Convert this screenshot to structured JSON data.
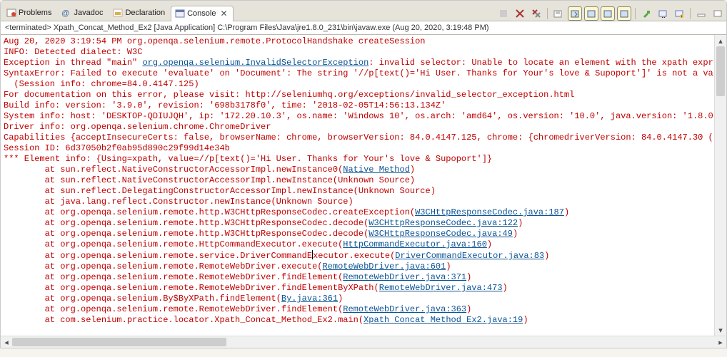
{
  "tabs": {
    "problems": "Problems",
    "javadoc": "Javadoc",
    "declaration": "Declaration",
    "console": "Console"
  },
  "breadcrumb": "<terminated> Xpath_Concat_Method_Ex2 [Java Application] C:\\Program Files\\Java\\jre1.8.0_231\\bin\\javaw.exe (Aug 20, 2020, 3:19:48 PM)",
  "lines": {
    "l0": "Aug 20, 2020 3:19:54 PM org.openqa.selenium.remote.ProtocolHandshake createSession",
    "l1": "INFO: Detected dialect: W3C",
    "l2a": "Exception in thread \"main\" ",
    "l2b": "org.openqa.selenium.InvalidSelectorException",
    "l2c": ": invalid selector: Unable to locate an element with the xpath expr",
    "l3": "SyntaxError: Failed to execute 'evaluate' on 'Document': The string '//p[text()='Hi User. Thanks for Your's love & Supoport']' is not a va",
    "l4": "  (Session info: chrome=84.0.4147.125)",
    "l5": "For documentation on this error, please visit: http://seleniumhq.org/exceptions/invalid_selector_exception.html",
    "l6": "Build info: version: '3.9.0', revision: '698b3178f0', time: '2018-02-05T14:56:13.134Z'",
    "l7": "System info: host: 'DESKTOP-QDIUJQH', ip: '172.20.10.3', os.name: 'Windows 10', os.arch: 'amd64', os.version: '10.0', java.version: '1.8.0",
    "l8": "Driver info: org.openqa.selenium.chrome.ChromeDriver",
    "l9": "Capabilities {acceptInsecureCerts: false, browserName: chrome, browserVersion: 84.0.4147.125, chrome: {chromedriverVersion: 84.0.4147.30 (",
    "l10": "Session ID: 6d37050b2f0ab95d890c29f99d14e34b",
    "l11": "*** Element info: {Using=xpath, value=//p[text()='Hi User. Thanks for Your's love & Supoport']}",
    "l12a": "        at sun.reflect.NativeConstructorAccessorImpl.newInstance0(",
    "l12b": "Native Method",
    "l12c": ")",
    "l13": "        at sun.reflect.NativeConstructorAccessorImpl.newInstance(Unknown Source)",
    "l14": "        at sun.reflect.DelegatingConstructorAccessorImpl.newInstance(Unknown Source)",
    "l15": "        at java.lang.reflect.Constructor.newInstance(Unknown Source)",
    "l16a": "        at org.openqa.selenium.remote.http.W3CHttpResponseCodec.createException(",
    "l16b": "W3CHttpResponseCodec.java:187",
    "l17a": "        at org.openqa.selenium.remote.http.W3CHttpResponseCodec.decode(",
    "l17b": "W3CHttpResponseCodec.java:122",
    "l18a": "        at org.openqa.selenium.remote.http.W3CHttpResponseCodec.decode(",
    "l18b": "W3CHttpResponseCodec.java:49",
    "l19a": "        at org.openqa.selenium.remote.HttpCommandExecutor.execute(",
    "l19b": "HttpCommandExecutor.java:160",
    "l20a": "        at org.openqa.selenium.remote.service.DriverCommandE",
    "l20b": "xecutor.execute(",
    "l20c": "DriverCommandExecutor.java:83",
    "l21a": "        at org.openqa.selenium.remote.RemoteWebDriver.execute(",
    "l21b": "RemoteWebDriver.java:601",
    "l22a": "        at org.openqa.selenium.remote.RemoteWebDriver.findElement(",
    "l22b": "RemoteWebDriver.java:371",
    "l23a": "        at org.openqa.selenium.remote.RemoteWebDriver.findElementByXPath(",
    "l23b": "RemoteWebDriver.java:473",
    "l24a": "        at org.openqa.selenium.By$ByXPath.findElement(",
    "l24b": "By.java:361",
    "l25a": "        at org.openqa.selenium.remote.RemoteWebDriver.findElement(",
    "l25b": "RemoteWebDriver.java:363",
    "l26a": "        at com.selenium.practice.locator.Xpath_Concat_Method_Ex2.main(",
    "l26b": "Xpath Concat Method Ex2.java:19"
  }
}
